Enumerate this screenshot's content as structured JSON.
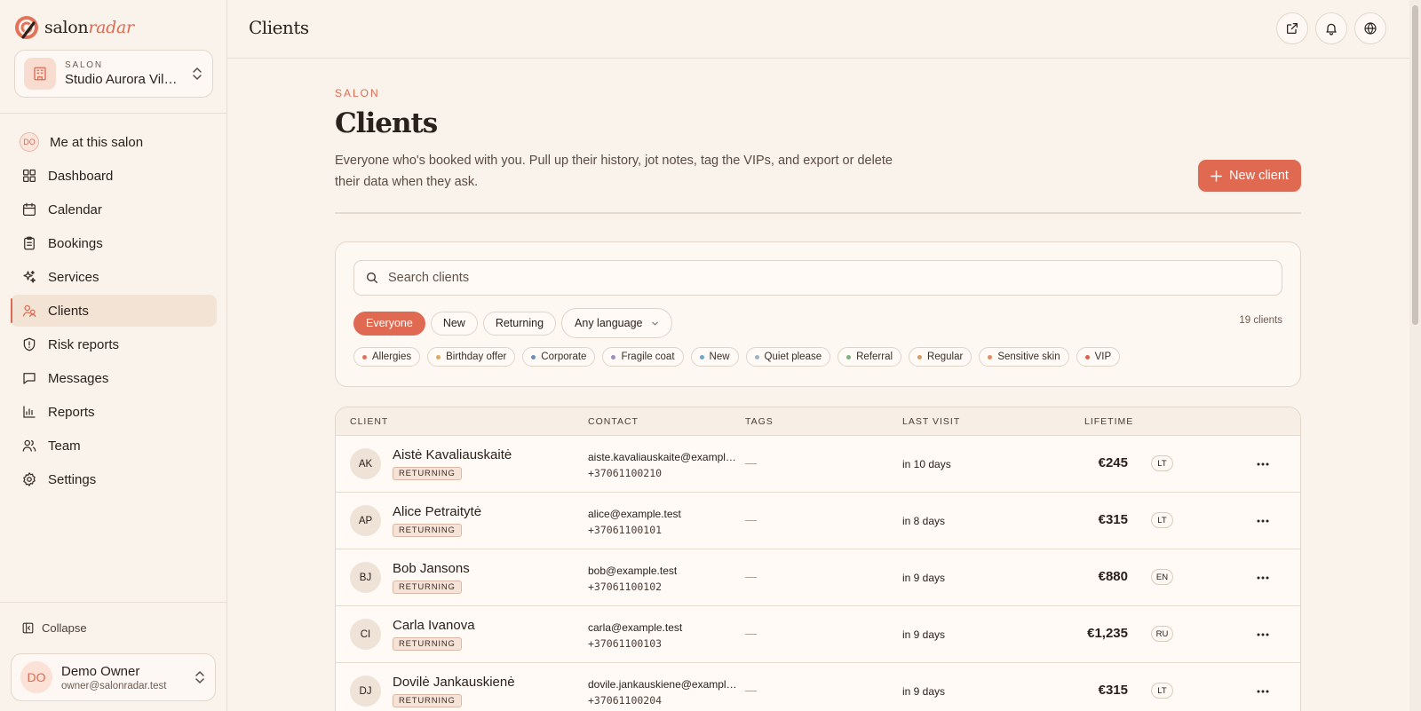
{
  "brand": {
    "name_part1": "salon",
    "name_part2": "radar"
  },
  "salon_switcher": {
    "kicker": "SALON",
    "name": "Studio Aurora Vilnius"
  },
  "nav": {
    "me": {
      "badge": "DO",
      "label": "Me at this salon"
    },
    "items": [
      {
        "label": "Dashboard",
        "icon": "dashboard-icon"
      },
      {
        "label": "Calendar",
        "icon": "calendar-icon"
      },
      {
        "label": "Bookings",
        "icon": "clipboard-icon"
      },
      {
        "label": "Services",
        "icon": "sparkles-icon"
      },
      {
        "label": "Clients",
        "icon": "clients-icon",
        "active": true
      },
      {
        "label": "Risk reports",
        "icon": "shield-alert-icon"
      },
      {
        "label": "Messages",
        "icon": "message-icon"
      },
      {
        "label": "Reports",
        "icon": "bar-chart-icon"
      },
      {
        "label": "Team",
        "icon": "users-icon"
      },
      {
        "label": "Settings",
        "icon": "gear-icon"
      }
    ]
  },
  "sidebar_footer": {
    "collapse_label": "Collapse"
  },
  "user": {
    "initials": "DO",
    "name": "Demo Owner",
    "email": "owner@salonradar.test"
  },
  "topbar": {
    "title": "Clients"
  },
  "page": {
    "kicker": "SALON",
    "title": "Clients",
    "description": "Everyone who's booked with you. Pull up their history, jot notes, tag the VIPs, and export or delete their data when they ask.",
    "new_client_label": "New client"
  },
  "filters": {
    "search_placeholder": "Search clients",
    "segments": [
      "Everyone",
      "New",
      "Returning"
    ],
    "active_segment": "Everyone",
    "language_label": "Any language",
    "count": "19 clients",
    "tags": [
      {
        "label": "Allergies",
        "color": "#e0735c"
      },
      {
        "label": "Birthday offer",
        "color": "#e0a85c"
      },
      {
        "label": "Corporate",
        "color": "#6f8fb8"
      },
      {
        "label": "Fragile coat",
        "color": "#9b8ec0"
      },
      {
        "label": "New",
        "color": "#6fa6c9"
      },
      {
        "label": "Quiet please",
        "color": "#9fb3c4"
      },
      {
        "label": "Referral",
        "color": "#7fb07f"
      },
      {
        "label": "Regular",
        "color": "#d99a5e"
      },
      {
        "label": "Sensitive skin",
        "color": "#e08e63"
      },
      {
        "label": "VIP",
        "color": "#e0604c"
      }
    ]
  },
  "table": {
    "columns": {
      "client": "CLIENT",
      "contact": "CONTACT",
      "tags": "TAGS",
      "last_visit": "LAST VISIT",
      "lifetime": "LIFETIME"
    },
    "rows": [
      {
        "initials": "AK",
        "name": "Aistė Kavaliauskaitė",
        "status": "RETURNING",
        "email": "aiste.kavaliauskaite@example.test",
        "phone": "+37061100210",
        "tags": "—",
        "last_visit": "in 10 days",
        "lifetime": "€245",
        "lang": "LT"
      },
      {
        "initials": "AP",
        "name": "Alice Petraitytė",
        "status": "RETURNING",
        "email": "alice@example.test",
        "phone": "+37061100101",
        "tags": "—",
        "last_visit": "in 8 days",
        "lifetime": "€315",
        "lang": "LT"
      },
      {
        "initials": "BJ",
        "name": "Bob Jansons",
        "status": "RETURNING",
        "email": "bob@example.test",
        "phone": "+37061100102",
        "tags": "—",
        "last_visit": "in 9 days",
        "lifetime": "€880",
        "lang": "EN"
      },
      {
        "initials": "CI",
        "name": "Carla Ivanova",
        "status": "RETURNING",
        "email": "carla@example.test",
        "phone": "+37061100103",
        "tags": "—",
        "last_visit": "in 9 days",
        "lifetime": "€1,235",
        "lang": "RU"
      },
      {
        "initials": "DJ",
        "name": "Dovilė Jankauskienė",
        "status": "RETURNING",
        "email": "dovile.jankauskiene@example.test",
        "phone": "+37061100204",
        "tags": "—",
        "last_visit": "in 9 days",
        "lifetime": "€315",
        "lang": "LT"
      }
    ]
  },
  "colors": {
    "accent": "#df6a51",
    "background": "#faf3ec"
  }
}
